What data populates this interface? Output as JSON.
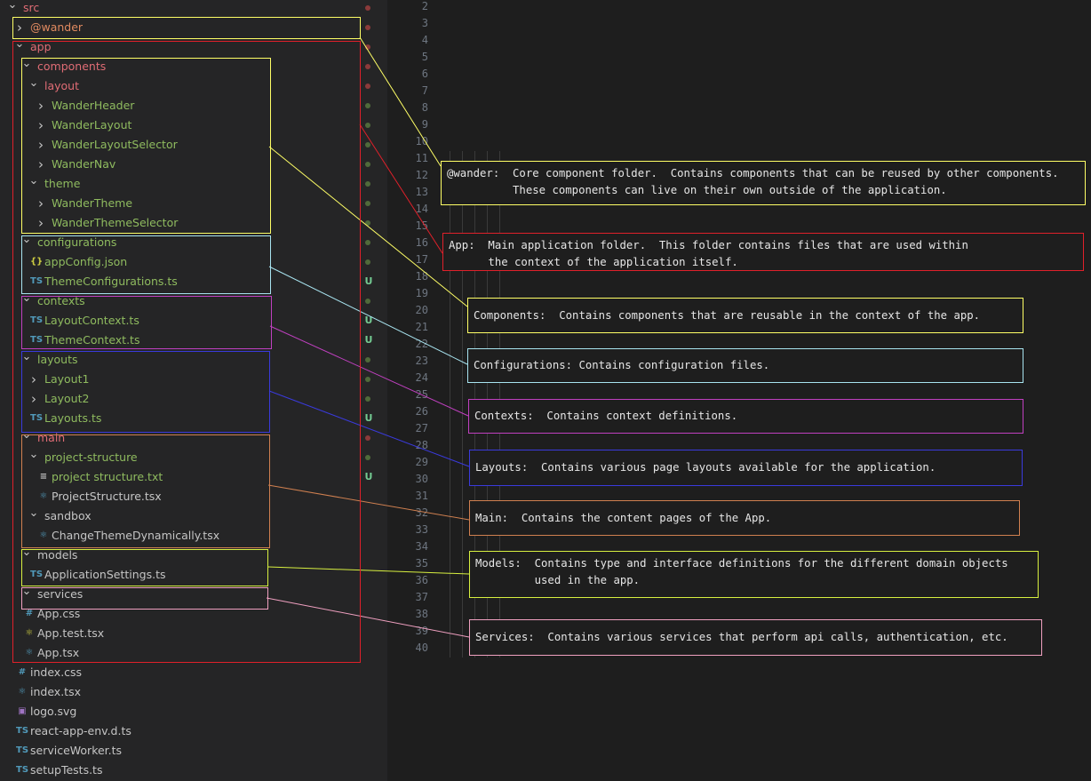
{
  "explorer": {
    "rows": [
      {
        "label": "src",
        "chevron": "open",
        "color": "#e06c75",
        "badge": "dot",
        "badge_color": "#8b3a3a",
        "icon": "",
        "depth": 0
      },
      {
        "label": "@wander",
        "chevron": "closed",
        "color": "#e08a60",
        "badge": "dot",
        "badge_color": "#8b3a3a",
        "icon": "",
        "depth": 1
      },
      {
        "label": "app",
        "chevron": "open",
        "color": "#e06c75",
        "badge": "dot",
        "badge_color": "#8b3a3a",
        "icon": "",
        "depth": 1
      },
      {
        "label": "components",
        "chevron": "open",
        "color": "#e06c75",
        "badge": "dot",
        "badge_color": "#8b3a3a",
        "icon": "",
        "depth": 2
      },
      {
        "label": "layout",
        "chevron": "open",
        "color": "#e06c75",
        "badge": "dot",
        "badge_color": "#8b3a3a",
        "icon": "",
        "depth": 3
      },
      {
        "label": "WanderHeader",
        "chevron": "closed",
        "color": "#8fbb5f",
        "badge": "dot",
        "badge_color": "#4f6b3a",
        "icon": "",
        "depth": 4
      },
      {
        "label": "WanderLayout",
        "chevron": "closed",
        "color": "#8fbb5f",
        "badge": "dot",
        "badge_color": "#4f6b3a",
        "icon": "",
        "depth": 4
      },
      {
        "label": "WanderLayoutSelector",
        "chevron": "closed",
        "color": "#8fbb5f",
        "badge": "dot",
        "badge_color": "#4f6b3a",
        "icon": "",
        "depth": 4
      },
      {
        "label": "WanderNav",
        "chevron": "closed",
        "color": "#8fbb5f",
        "badge": "dot",
        "badge_color": "#4f6b3a",
        "icon": "",
        "depth": 4
      },
      {
        "label": "theme",
        "chevron": "open",
        "color": "#8fbb5f",
        "badge": "dot",
        "badge_color": "#4f6b3a",
        "icon": "",
        "depth": 3
      },
      {
        "label": "WanderTheme",
        "chevron": "closed",
        "color": "#8fbb5f",
        "badge": "dot",
        "badge_color": "#4f6b3a",
        "icon": "",
        "depth": 4
      },
      {
        "label": "WanderThemeSelector",
        "chevron": "closed",
        "color": "#8fbb5f",
        "badge": "dot",
        "badge_color": "#4f6b3a",
        "icon": "",
        "depth": 4
      },
      {
        "label": "configurations",
        "chevron": "open",
        "color": "#8fbb5f",
        "badge": "dot",
        "badge_color": "#4f6b3a",
        "icon": "",
        "depth": 2
      },
      {
        "label": "appConfig.json",
        "chevron": "none",
        "color": "#8fbb5f",
        "badge": "dot",
        "badge_color": "#4f6b3a",
        "icon": "{}",
        "icon_color": "#cbcb41",
        "depth": 3
      },
      {
        "label": "ThemeConfigurations.ts",
        "chevron": "none",
        "color": "#8fbb5f",
        "badge": "U",
        "badge_color": "#73c991",
        "icon": "TS",
        "icon_color": "#519aba",
        "depth": 3
      },
      {
        "label": "contexts",
        "chevron": "open",
        "color": "#8fbb5f",
        "badge": "dot",
        "badge_color": "#4f6b3a",
        "icon": "",
        "depth": 2
      },
      {
        "label": "LayoutContext.ts",
        "chevron": "none",
        "color": "#8fbb5f",
        "badge": "U",
        "badge_color": "#73c991",
        "icon": "TS",
        "icon_color": "#519aba",
        "depth": 3
      },
      {
        "label": "ThemeContext.ts",
        "chevron": "none",
        "color": "#8fbb5f",
        "badge": "U",
        "badge_color": "#73c991",
        "icon": "TS",
        "icon_color": "#519aba",
        "depth": 3
      },
      {
        "label": "layouts",
        "chevron": "open",
        "color": "#8fbb5f",
        "badge": "dot",
        "badge_color": "#4f6b3a",
        "icon": "",
        "depth": 2
      },
      {
        "label": "Layout1",
        "chevron": "closed",
        "color": "#8fbb5f",
        "badge": "dot",
        "badge_color": "#4f6b3a",
        "icon": "",
        "depth": 3
      },
      {
        "label": "Layout2",
        "chevron": "closed",
        "color": "#8fbb5f",
        "badge": "dot",
        "badge_color": "#4f6b3a",
        "icon": "",
        "depth": 3
      },
      {
        "label": "Layouts.ts",
        "chevron": "none",
        "color": "#8fbb5f",
        "badge": "U",
        "badge_color": "#73c991",
        "icon": "TS",
        "icon_color": "#519aba",
        "depth": 3
      },
      {
        "label": "main",
        "chevron": "open",
        "color": "#e06c75",
        "badge": "dot",
        "badge_color": "#8b3a3a",
        "icon": "",
        "depth": 2
      },
      {
        "label": "project-structure",
        "chevron": "open",
        "color": "#8fbb5f",
        "badge": "dot",
        "badge_color": "#4f6b3a",
        "icon": "",
        "depth": 3
      },
      {
        "label": "project structure.txt",
        "chevron": "none",
        "color": "#8fbb5f",
        "badge": "U",
        "badge_color": "#73c991",
        "icon": "≡",
        "icon_color": "#c5c5c5",
        "depth": 4
      },
      {
        "label": "ProjectStructure.tsx",
        "chevron": "none",
        "color": "#c5c5c5",
        "badge": "",
        "badge_color": "",
        "icon": "⚛",
        "icon_color": "#519aba",
        "depth": 4
      },
      {
        "label": "sandbox",
        "chevron": "open",
        "color": "#c5c5c5",
        "badge": "",
        "badge_color": "",
        "icon": "",
        "depth": 3
      },
      {
        "label": "ChangeThemeDynamically.tsx",
        "chevron": "none",
        "color": "#c5c5c5",
        "badge": "",
        "badge_color": "",
        "icon": "⚛",
        "icon_color": "#519aba",
        "depth": 4
      },
      {
        "label": "models",
        "chevron": "open",
        "color": "#c5c5c5",
        "badge": "",
        "badge_color": "",
        "icon": "",
        "depth": 2
      },
      {
        "label": "ApplicationSettings.ts",
        "chevron": "none",
        "color": "#c5c5c5",
        "badge": "",
        "badge_color": "",
        "icon": "TS",
        "icon_color": "#519aba",
        "depth": 3
      },
      {
        "label": "services",
        "chevron": "open",
        "color": "#c5c5c5",
        "badge": "",
        "badge_color": "",
        "icon": "",
        "depth": 2
      },
      {
        "label": "App.css",
        "chevron": "none",
        "color": "#c5c5c5",
        "badge": "",
        "badge_color": "",
        "icon": "#",
        "icon_color": "#519aba",
        "depth": 2
      },
      {
        "label": "App.test.tsx",
        "chevron": "none",
        "color": "#c5c5c5",
        "badge": "",
        "badge_color": "",
        "icon": "⚛",
        "icon_color": "#cbcb41",
        "depth": 2
      },
      {
        "label": "App.tsx",
        "chevron": "none",
        "color": "#c5c5c5",
        "badge": "",
        "badge_color": "",
        "icon": "⚛",
        "icon_color": "#519aba",
        "depth": 2
      },
      {
        "label": "index.css",
        "chevron": "none",
        "color": "#c5c5c5",
        "badge": "",
        "badge_color": "",
        "icon": "#",
        "icon_color": "#519aba",
        "depth": 1
      },
      {
        "label": "index.tsx",
        "chevron": "none",
        "color": "#c5c5c5",
        "badge": "",
        "badge_color": "",
        "icon": "⚛",
        "icon_color": "#519aba",
        "depth": 1
      },
      {
        "label": "logo.svg",
        "chevron": "none",
        "color": "#c5c5c5",
        "badge": "",
        "badge_color": "",
        "icon": "▣",
        "icon_color": "#a074c4",
        "depth": 1
      },
      {
        "label": "react-app-env.d.ts",
        "chevron": "none",
        "color": "#c5c5c5",
        "badge": "",
        "badge_color": "",
        "icon": "TS",
        "icon_color": "#519aba",
        "depth": 1
      },
      {
        "label": "serviceWorker.ts",
        "chevron": "none",
        "color": "#c5c5c5",
        "badge": "",
        "badge_color": "",
        "icon": "TS",
        "icon_color": "#519aba",
        "depth": 1
      },
      {
        "label": "setupTests.ts",
        "chevron": "none",
        "color": "#c5c5c5",
        "badge": "",
        "badge_color": "",
        "icon": "TS",
        "icon_color": "#519aba",
        "depth": 1
      }
    ]
  },
  "editor": {
    "line_numbers": [
      "2",
      "3",
      "4",
      "5",
      "6",
      "7",
      "8",
      "9",
      "10",
      "11",
      "12",
      "13",
      "14",
      "15",
      "16",
      "17",
      "18",
      "19",
      "20",
      "21",
      "22",
      "23",
      "24",
      "25",
      "26",
      "27",
      "28",
      "29",
      "30",
      "31",
      "32",
      "33",
      "34",
      "35",
      "36",
      "37",
      "38",
      "39",
      "40"
    ]
  },
  "annotations": [
    {
      "id": "wander",
      "color": "#ffff66",
      "line1": "@wander:  Core component folder.  Contains components that can be reused by other components.",
      "line2": "          These components can live on their own outside of the application."
    },
    {
      "id": "app",
      "color": "#e0202a",
      "line1": "App:  Main application folder.  This folder contains files that are used within",
      "line2": "      the context of the application itself."
    },
    {
      "id": "components",
      "color": "#ffff66",
      "line1": "Components:  Contains components that are reusable in the context of the app.",
      "line2": ""
    },
    {
      "id": "configurations",
      "color": "#a8e4f0",
      "line1": "Configurations: Contains configuration files.",
      "line2": ""
    },
    {
      "id": "contexts",
      "color": "#c040c0",
      "line1": "Contexts:  Contains context definitions.",
      "line2": ""
    },
    {
      "id": "layouts",
      "color": "#3a3adc",
      "line1": "Layouts:  Contains various page layouts available for the application.",
      "line2": ""
    },
    {
      "id": "main",
      "color": "#d08050",
      "line1": "Main:  Contains the content pages of the App.",
      "line2": ""
    },
    {
      "id": "models",
      "color": "#d8f040",
      "line1": "Models:  Contains type and interface definitions for the different domain objects",
      "line2": "         used in the app."
    },
    {
      "id": "services",
      "color": "#f0a0c0",
      "line1": "Services:  Contains various services that perform api calls, authentication, etc.",
      "line2": ""
    }
  ]
}
